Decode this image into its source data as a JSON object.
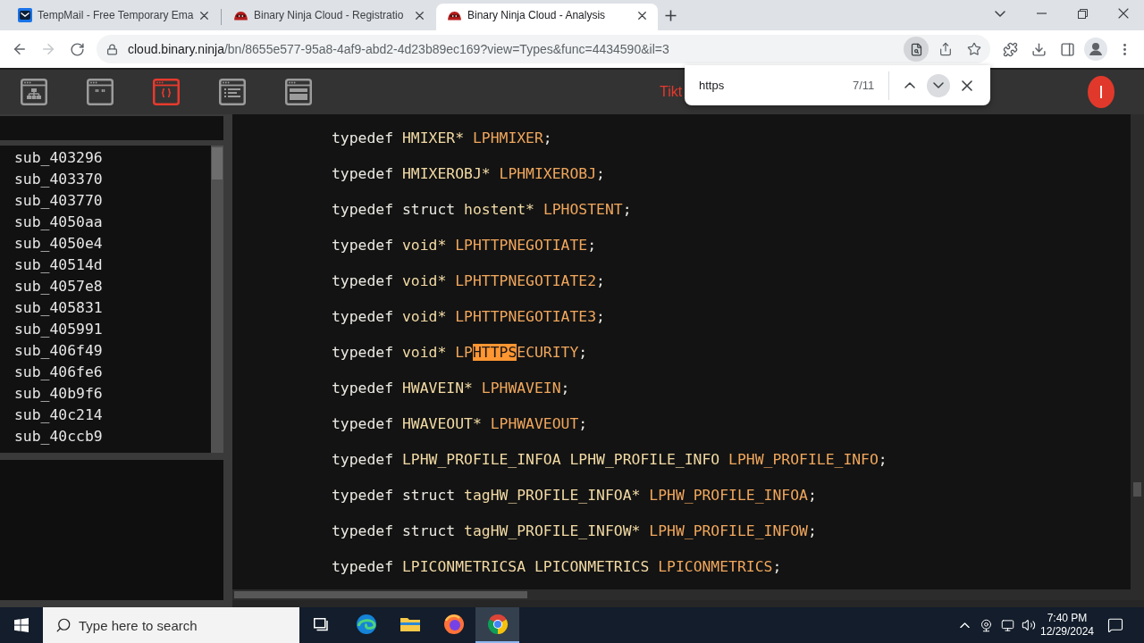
{
  "browser": {
    "tabs": [
      {
        "kind": "mail",
        "title": "TempMail - Free Temporary Ema",
        "selected": false
      },
      {
        "kind": "ninja",
        "title": "Binary Ninja Cloud - Registratio",
        "selected": false
      },
      {
        "kind": "ninja",
        "title": "Binary Ninja Cloud - Analysis",
        "selected": true
      }
    ],
    "address": {
      "host": "cloud.binary.ninja",
      "path": "/bn/8655e577-95a8-4af9-abd2-4d23b89ec169?view=Types&func=4434590&il=3"
    }
  },
  "find_bar": {
    "value": "https",
    "count": "7/11"
  },
  "app": {
    "views": [
      {
        "kind": "graph",
        "selected": false
      },
      {
        "kind": "strings",
        "selected": false
      },
      {
        "kind": "types",
        "selected": true
      },
      {
        "kind": "linear",
        "selected": false
      },
      {
        "kind": "hex",
        "selected": false
      }
    ],
    "title": "Tikt",
    "avatar": "I",
    "functions": [
      "sub_403296",
      "sub_403370",
      "sub_403770",
      "sub_4050aa",
      "sub_4050e4",
      "sub_40514d",
      "sub_4057e8",
      "sub_405831",
      "sub_405991",
      "sub_406f49",
      "sub_406fe6",
      "sub_40b9f6",
      "sub_40c214",
      "sub_40ccb9"
    ],
    "code_lines": [
      {
        "words": [
          [
            {
              "text": "typedef",
              "kind": "keyword"
            }
          ],
          [
            {
              "text": "HMIXER*",
              "kind": "type"
            }
          ],
          [
            {
              "text": "LPHMIXER",
              "kind": "name"
            },
            {
              "text": ";",
              "kind": "punct"
            }
          ]
        ]
      },
      {
        "words": [
          [
            {
              "text": "typedef",
              "kind": "keyword"
            }
          ],
          [
            {
              "text": "HMIXEROBJ*",
              "kind": "type"
            }
          ],
          [
            {
              "text": "LPHMIXEROBJ",
              "kind": "name"
            },
            {
              "text": ";",
              "kind": "punct"
            }
          ]
        ]
      },
      {
        "words": [
          [
            {
              "text": "typedef",
              "kind": "keyword"
            }
          ],
          [
            {
              "text": "struct",
              "kind": "keyword"
            }
          ],
          [
            {
              "text": "hostent*",
              "kind": "type"
            }
          ],
          [
            {
              "text": "LPHOSTENT",
              "kind": "name"
            },
            {
              "text": ";",
              "kind": "punct"
            }
          ]
        ]
      },
      {
        "words": [
          [
            {
              "text": "typedef",
              "kind": "keyword"
            }
          ],
          [
            {
              "text": "void*",
              "kind": "type"
            }
          ],
          [
            {
              "text": "LPHTTPNEGOTIATE",
              "kind": "name"
            },
            {
              "text": ";",
              "kind": "punct"
            }
          ]
        ]
      },
      {
        "words": [
          [
            {
              "text": "typedef",
              "kind": "keyword"
            }
          ],
          [
            {
              "text": "void*",
              "kind": "type"
            }
          ],
          [
            {
              "text": "LPHTTPNEGOTIATE2",
              "kind": "name"
            },
            {
              "text": ";",
              "kind": "punct"
            }
          ]
        ]
      },
      {
        "words": [
          [
            {
              "text": "typedef",
              "kind": "keyword"
            }
          ],
          [
            {
              "text": "void*",
              "kind": "type"
            }
          ],
          [
            {
              "text": "LPHTTPNEGOTIATE3",
              "kind": "name"
            },
            {
              "text": ";",
              "kind": "punct"
            }
          ]
        ]
      },
      {
        "words": [
          [
            {
              "text": "typedef",
              "kind": "keyword"
            }
          ],
          [
            {
              "text": "void*",
              "kind": "type"
            }
          ],
          [
            {
              "text": "LP",
              "kind": "name"
            },
            {
              "text": "HTTPS",
              "kind": "match"
            },
            {
              "text": "ECURITY",
              "kind": "name"
            },
            {
              "text": ";",
              "kind": "punct"
            }
          ]
        ]
      },
      {
        "words": [
          [
            {
              "text": "typedef",
              "kind": "keyword"
            }
          ],
          [
            {
              "text": "HWAVEIN*",
              "kind": "type"
            }
          ],
          [
            {
              "text": "LPHWAVEIN",
              "kind": "name"
            },
            {
              "text": ";",
              "kind": "punct"
            }
          ]
        ]
      },
      {
        "words": [
          [
            {
              "text": "typedef",
              "kind": "keyword"
            }
          ],
          [
            {
              "text": "HWAVEOUT*",
              "kind": "type"
            }
          ],
          [
            {
              "text": "LPHWAVEOUT",
              "kind": "name"
            },
            {
              "text": ";",
              "kind": "punct"
            }
          ]
        ]
      },
      {
        "words": [
          [
            {
              "text": "typedef",
              "kind": "keyword"
            }
          ],
          [
            {
              "text": "LPHW_PROFILE_INFOA",
              "kind": "type"
            }
          ],
          [
            {
              "text": "LPHW_PROFILE_INFO",
              "kind": "type"
            }
          ],
          [
            {
              "text": "LPHW_PROFILE_INFO",
              "kind": "name"
            },
            {
              "text": ";",
              "kind": "punct"
            }
          ]
        ]
      },
      {
        "words": [
          [
            {
              "text": "typedef",
              "kind": "keyword"
            }
          ],
          [
            {
              "text": "struct",
              "kind": "keyword"
            }
          ],
          [
            {
              "text": "tagHW_PROFILE_INFOA*",
              "kind": "type"
            }
          ],
          [
            {
              "text": "LPHW_PROFILE_INFOA",
              "kind": "name"
            },
            {
              "text": ";",
              "kind": "punct"
            }
          ]
        ]
      },
      {
        "words": [
          [
            {
              "text": "typedef",
              "kind": "keyword"
            }
          ],
          [
            {
              "text": "struct",
              "kind": "keyword"
            }
          ],
          [
            {
              "text": "tagHW_PROFILE_INFOW*",
              "kind": "type"
            }
          ],
          [
            {
              "text": "LPHW_PROFILE_INFOW",
              "kind": "name"
            },
            {
              "text": ";",
              "kind": "punct"
            }
          ]
        ]
      },
      {
        "words": [
          [
            {
              "text": "typedef",
              "kind": "keyword"
            }
          ],
          [
            {
              "text": "LPICONMETRICSA",
              "kind": "type"
            }
          ],
          [
            {
              "text": "LPICONMETRICS",
              "kind": "type"
            }
          ],
          [
            {
              "text": "LPICONMETRICS",
              "kind": "name"
            },
            {
              "text": ";",
              "kind": "punct"
            }
          ]
        ]
      }
    ]
  },
  "taskbar": {
    "search": {
      "placeholder": "Type here to search"
    },
    "apps": [
      {
        "kind": "edge",
        "selected": false
      },
      {
        "kind": "explorer",
        "selected": false
      },
      {
        "kind": "firefox",
        "selected": false
      },
      {
        "kind": "chrome",
        "selected": true
      }
    ],
    "time": "7:40 PM",
    "date": "12/29/2024"
  }
}
